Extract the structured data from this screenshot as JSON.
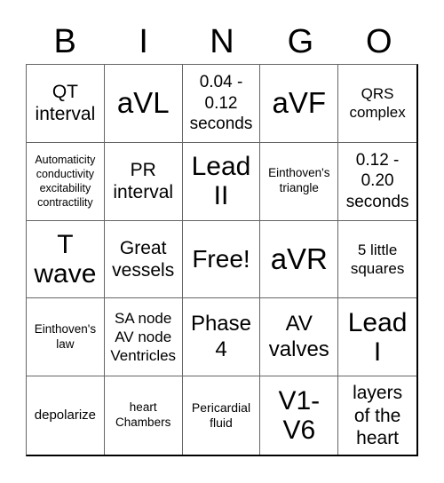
{
  "header": {
    "letters": [
      "B",
      "I",
      "N",
      "G",
      "O"
    ]
  },
  "grid": {
    "rows": [
      [
        "QT interval",
        "aVL",
        "0.04 - 0.12 seconds",
        "aVF",
        "QRS complex"
      ],
      [
        "Automaticity conductivity excitability contractility",
        "PR interval",
        "Lead II",
        "Einthoven's triangle",
        "0.12 - 0.20 seconds"
      ],
      [
        "T wave",
        "Great vessels",
        "Free!",
        "aVR",
        "5 little squares"
      ],
      [
        "Einthoven's law",
        "SA node AV node Ventricles",
        "Phase 4",
        "AV valves",
        "Lead I"
      ],
      [
        "depolarize",
        "heart Chambers",
        "Pericardial fluid",
        "V1-V6",
        "layers of the heart"
      ]
    ]
  }
}
